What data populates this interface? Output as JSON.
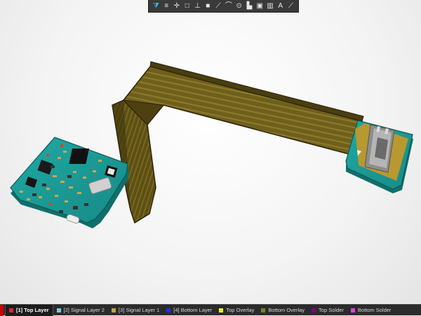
{
  "toolbar": {
    "tools": [
      {
        "icon": "filter-icon",
        "glyph": "⧩",
        "active": true
      },
      {
        "icon": "layer-stack-icon",
        "glyph": "≡"
      },
      {
        "icon": "crosshair-icon",
        "glyph": "✛"
      },
      {
        "icon": "select-rectangle-icon",
        "glyph": "□"
      },
      {
        "icon": "align-icon",
        "glyph": "⊥"
      },
      {
        "icon": "component-icon",
        "glyph": "■"
      },
      {
        "icon": "route-icon",
        "glyph": "⟋"
      },
      {
        "icon": "arc-icon",
        "glyph": "⌒"
      },
      {
        "icon": "via-icon",
        "glyph": "⊙"
      },
      {
        "icon": "place-pad-icon",
        "glyph": "▙"
      },
      {
        "icon": "polygon-pour-icon",
        "glyph": "▣"
      },
      {
        "icon": "chart-icon",
        "glyph": "▥"
      },
      {
        "icon": "text-icon",
        "glyph": "A"
      },
      {
        "icon": "line-icon",
        "glyph": "⟋"
      }
    ]
  },
  "layers": [
    {
      "name": "[1] Top Layer",
      "color": "#e8202a",
      "active": true
    },
    {
      "name": "[2] Signal Layer 2",
      "color": "#7ec8e3"
    },
    {
      "name": "[3] Signal Layer 1",
      "color": "#c8a040"
    },
    {
      "name": "[4] Bottom Layer",
      "color": "#2030e8"
    },
    {
      "name": "Top Overlay",
      "color": "#f0f020"
    },
    {
      "name": "Bottom Overlay",
      "color": "#808020"
    },
    {
      "name": "Top Solder",
      "color": "#800080"
    },
    {
      "name": "Bottom Solder",
      "color": "#e040e0"
    }
  ]
}
